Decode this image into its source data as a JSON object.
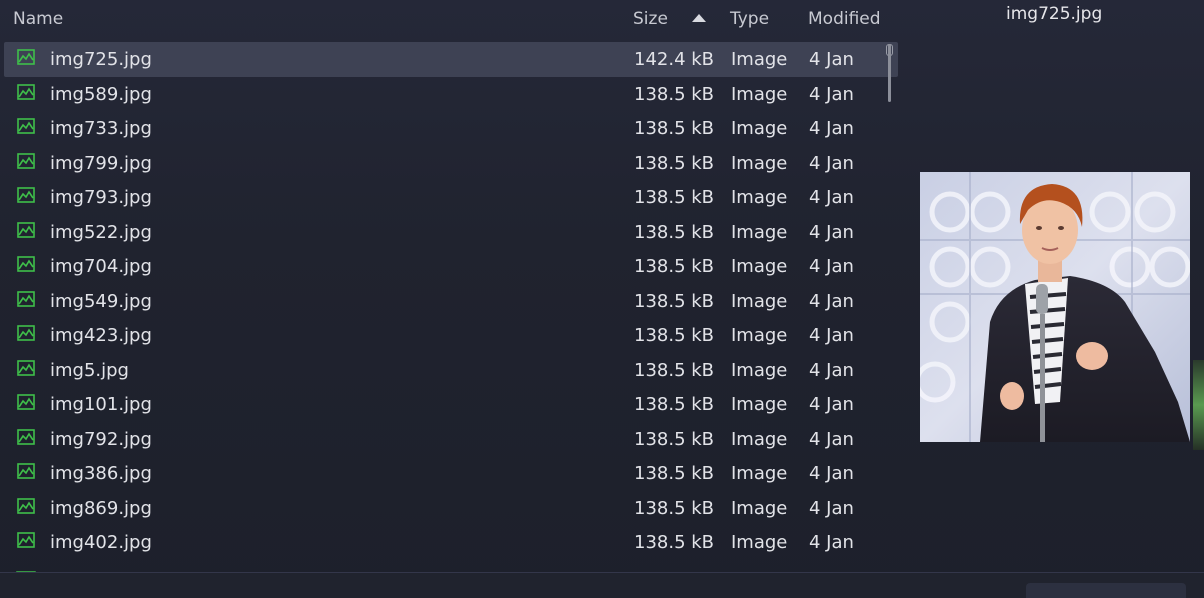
{
  "columns": {
    "name": "Name",
    "size": "Size",
    "type": "Type",
    "modified": "Modified"
  },
  "sort": {
    "column": "size",
    "direction": "ascending",
    "icon": "sort-up-arrow-icon"
  },
  "accent": {
    "icon_green": "#3fbf4a",
    "selection": "#3e4254"
  },
  "files": [
    {
      "name": "img725.jpg",
      "size": "142.4 kB",
      "type": "Image",
      "modified": "4 Jan",
      "selected": true
    },
    {
      "name": "img589.jpg",
      "size": "138.5 kB",
      "type": "Image",
      "modified": "4 Jan"
    },
    {
      "name": "img733.jpg",
      "size": "138.5 kB",
      "type": "Image",
      "modified": "4 Jan"
    },
    {
      "name": "img799.jpg",
      "size": "138.5 kB",
      "type": "Image",
      "modified": "4 Jan"
    },
    {
      "name": "img793.jpg",
      "size": "138.5 kB",
      "type": "Image",
      "modified": "4 Jan"
    },
    {
      "name": "img522.jpg",
      "size": "138.5 kB",
      "type": "Image",
      "modified": "4 Jan"
    },
    {
      "name": "img704.jpg",
      "size": "138.5 kB",
      "type": "Image",
      "modified": "4 Jan"
    },
    {
      "name": "img549.jpg",
      "size": "138.5 kB",
      "type": "Image",
      "modified": "4 Jan"
    },
    {
      "name": "img423.jpg",
      "size": "138.5 kB",
      "type": "Image",
      "modified": "4 Jan"
    },
    {
      "name": "img5.jpg",
      "size": "138.5 kB",
      "type": "Image",
      "modified": "4 Jan"
    },
    {
      "name": "img101.jpg",
      "size": "138.5 kB",
      "type": "Image",
      "modified": "4 Jan"
    },
    {
      "name": "img792.jpg",
      "size": "138.5 kB",
      "type": "Image",
      "modified": "4 Jan"
    },
    {
      "name": "img386.jpg",
      "size": "138.5 kB",
      "type": "Image",
      "modified": "4 Jan"
    },
    {
      "name": "img869.jpg",
      "size": "138.5 kB",
      "type": "Image",
      "modified": "4 Jan"
    },
    {
      "name": "img402.jpg",
      "size": "138.5 kB",
      "type": "Image",
      "modified": "4 Jan"
    }
  ],
  "preview": {
    "title": "img725.jpg",
    "image_description_icon": "photo-preview"
  }
}
